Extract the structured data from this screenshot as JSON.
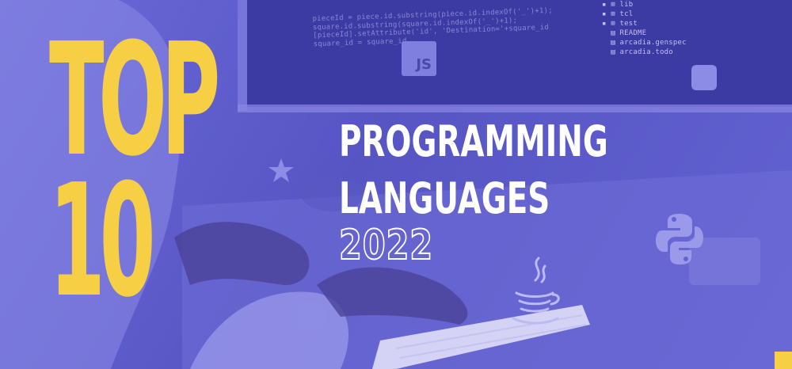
{
  "banner": {
    "top_label": "TOP",
    "ten_label": "10",
    "title_line1": "PROGRAMMING",
    "title_line2": "LANGUAGES",
    "year": "2022"
  },
  "badges": {
    "js_label": "JS"
  },
  "code_snippet": {
    "line1": "pieceId = piece.id.substring(piece.id.indexOf('_')+1);",
    "line2": "square.id.substring(square.id.indexOf('_')+1);",
    "line3": "[pieceId].setAttribute('id', 'Destination='+square_id",
    "line4": "square_id = square_id"
  },
  "file_tree": {
    "items": [
      "lib",
      "tcl",
      "test",
      "README",
      "arcadia.genspec",
      "arcadia.todo"
    ]
  },
  "colors": {
    "background": "#5d5bc8",
    "accent_yellow": "#f7cf45",
    "text_white": "#ffffff"
  },
  "icons": [
    "js-icon",
    "python-icon",
    "java-icon",
    "star-icon"
  ]
}
